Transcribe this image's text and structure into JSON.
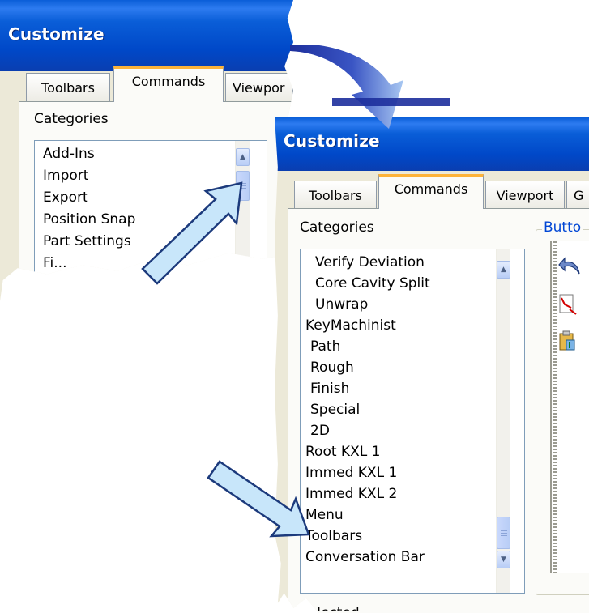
{
  "dialog_back": {
    "title": "Customize",
    "tabs": [
      "Toolbars",
      "Commands",
      "Viewpor"
    ],
    "active_tab": "Commands",
    "categories_label": "Categories",
    "categories": [
      "Add-Ins",
      "Import",
      "Export",
      "Position Snap",
      "Part Settings",
      "Fi..."
    ]
  },
  "dialog_front": {
    "title": "Customize",
    "tabs": [
      "Toolbars",
      "Commands",
      "Viewport",
      "G"
    ],
    "active_tab": "Commands",
    "categories_label": "Categories",
    "buttons_group_label": "Butto",
    "categories": [
      "Verify Deviation",
      "Core Cavity Split",
      "Unwrap",
      "KeyMachinist",
      "Path",
      "Rough",
      "Finish",
      "Special",
      "2D",
      "Root KXL 1",
      "Immed KXL 1",
      "Immed KXL 2",
      "Menu",
      "Toolbars",
      "Conversation Bar"
    ],
    "bottom_label_partial": "Selected"
  },
  "icons": {
    "scroll_up": "chevron-up-icon",
    "scroll_down": "chevron-down-icon",
    "callout_arrow": "callout-arrow-icon"
  },
  "colors": {
    "titlebar": "#0a5ed8",
    "dialog_face": "#ece9d8",
    "active_tab_accent": "#fdb33a",
    "arrow_fill": "#c8e6fa",
    "arrow_stroke": "#1c3a7c",
    "curved_arrow": "#2a3fa8"
  }
}
